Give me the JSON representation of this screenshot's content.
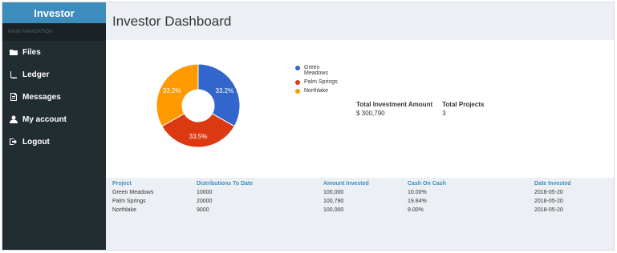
{
  "brand": "Investor",
  "nav_header": "MAIN NAVIGATION",
  "nav": [
    {
      "label": "Files",
      "icon": "folder-icon"
    },
    {
      "label": "Ledger",
      "icon": "book-icon"
    },
    {
      "label": "Messages",
      "icon": "document-icon"
    },
    {
      "label": "My account",
      "icon": "user-icon"
    },
    {
      "label": "Logout",
      "icon": "logout-icon"
    }
  ],
  "page_title": "Investor Dashboard",
  "chart_data": {
    "type": "pie",
    "categories": [
      "Green Meadows",
      "Palm Springs",
      "Northlake"
    ],
    "values": [
      33.2,
      33.5,
      33.2
    ],
    "labels": [
      "33.2%",
      "33.5%",
      "33.2%"
    ],
    "colors": [
      "#3366cc",
      "#dc3912",
      "#ff9900"
    ],
    "legend": "right"
  },
  "stats": {
    "total_investment_label": "Total Investment Amount",
    "total_investment_value": "$ 300,790",
    "total_projects_label": "Total Projects",
    "total_projects_value": "3"
  },
  "table": {
    "headers": [
      "Project",
      "Distributions To Date",
      "Amount Invested",
      "Cash On Cash",
      "Date Invested"
    ],
    "rows": [
      [
        "Green Meadows",
        "10000",
        "100,000",
        "10.00%",
        "2018-05-20"
      ],
      [
        "Palm Springs",
        "20000",
        "100,790",
        "19.84%",
        "2018-05-20"
      ],
      [
        "Northlake",
        "9000",
        "100,000",
        "9.00%",
        "2018-05-20"
      ]
    ]
  }
}
